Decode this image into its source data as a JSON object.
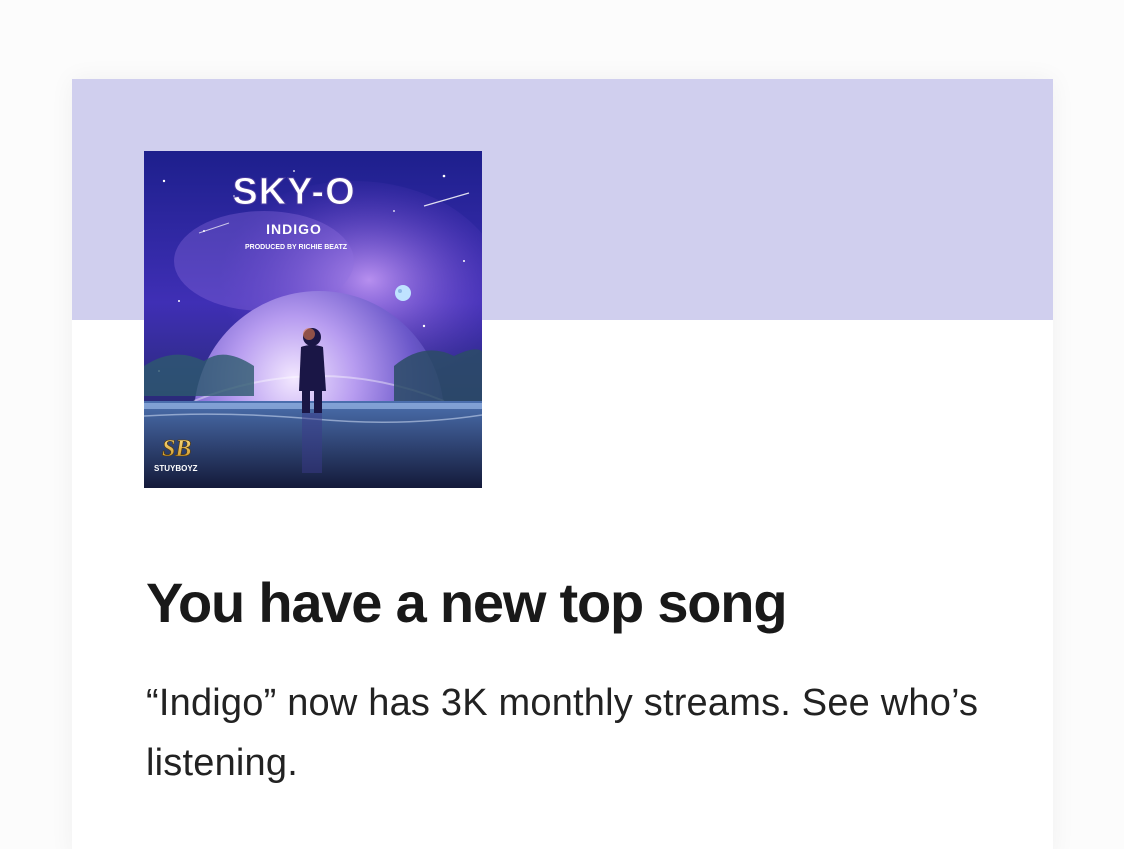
{
  "colors": {
    "banner": "#d0cfee",
    "headline": "#191919",
    "body": "#222222"
  },
  "cover": {
    "artist": "SKY-O",
    "title": "INDIGO",
    "credit": "PRODUCED BY RICHIE BEATZ",
    "logo_mark": "SB",
    "logo_name": "STUYBOYZ"
  },
  "notification": {
    "headline": "You have a new top song",
    "body": "“Indigo” now has 3K monthly streams. See who’s listening."
  }
}
